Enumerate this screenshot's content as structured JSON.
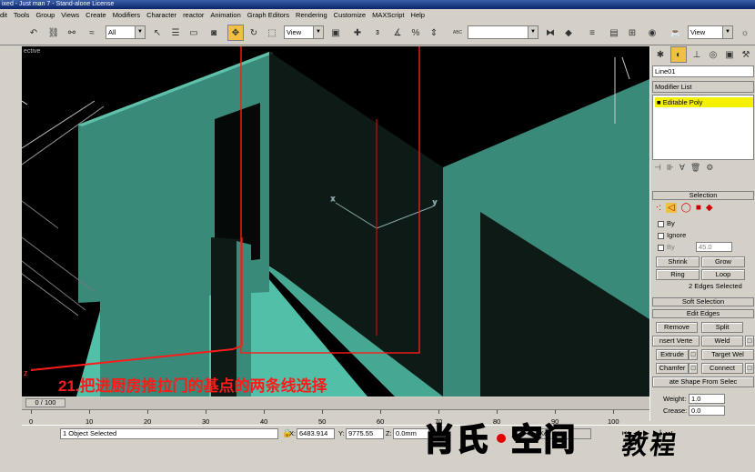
{
  "app": {
    "title_fragment": "ixed - Just man 7 - Stand-alone License"
  },
  "menu": [
    "dit",
    "Tools",
    "Group",
    "Views",
    "Create",
    "Modifiers",
    "Character",
    "reactor",
    "Animation",
    "Graph Editors",
    "Rendering",
    "Customize",
    "MAXScript",
    "Help"
  ],
  "toolbar": {
    "filter_select": "All",
    "refcoord_select": "View",
    "snap_value": "3",
    "named_selection": "",
    "right_view_select": "View",
    "snap_label": "ABC"
  },
  "viewport": {
    "label": "ective",
    "caption": "21.把进厨房推拉门的基点的两条线选择"
  },
  "command_panel": {
    "object_name": "Line01",
    "modifier_list_label": "Modifier List",
    "stack_item": "Editable Poly",
    "selection_rollout": "Selection",
    "by_vertex_label": "By",
    "ignore_label": "Ignore",
    "by_angle_label": "By",
    "angle_value": "45.0",
    "shrink_label": "Shrink",
    "grow_label": "Grow",
    "ring_label": "Ring",
    "loop_label": "Loop",
    "selection_status": "2 Edges Selected",
    "soft_selection_rollout": "Soft Selection",
    "edit_edges_rollout": "Edit Edges",
    "remove_label": "Remove",
    "split_label": "Split",
    "insert_vertex_label": "nsert Verte",
    "weld_label": "Weld",
    "extrude_label": "Extrude",
    "target_weld_label": "Target Wel",
    "chamfer_label": "Chamfer",
    "connect_label": "Connect",
    "create_shape_label": "ate Shape From Selec",
    "weight_label": "Weight:",
    "weight_value": "1.0",
    "crease_label": "Crease:",
    "crease_value": "0.0"
  },
  "timeline": {
    "frame_display": "0 / 100",
    "ticks": [
      "0",
      "10",
      "20",
      "30",
      "40",
      "50",
      "60",
      "70",
      "80",
      "90",
      "100"
    ]
  },
  "status": {
    "selected_text": "1 Object Selected",
    "x_label": "X:",
    "x_value": "6483.914",
    "y_label": "Y:",
    "y_value": "9775.55",
    "z_label": "Z:",
    "z_value": "0.0mm",
    "key_label": "Key"
  },
  "watermark": {
    "part1": "肖氏",
    "part2": "空间",
    "part3": "教程"
  },
  "colors": {
    "wall_teal": "#3a8a7a",
    "floor_teal": "#52c0a8",
    "dark_face": "#0d1a16",
    "selection_red": "#ff1a1a",
    "active_button": "#f0c040",
    "stack_highlight": "#f5f000"
  }
}
